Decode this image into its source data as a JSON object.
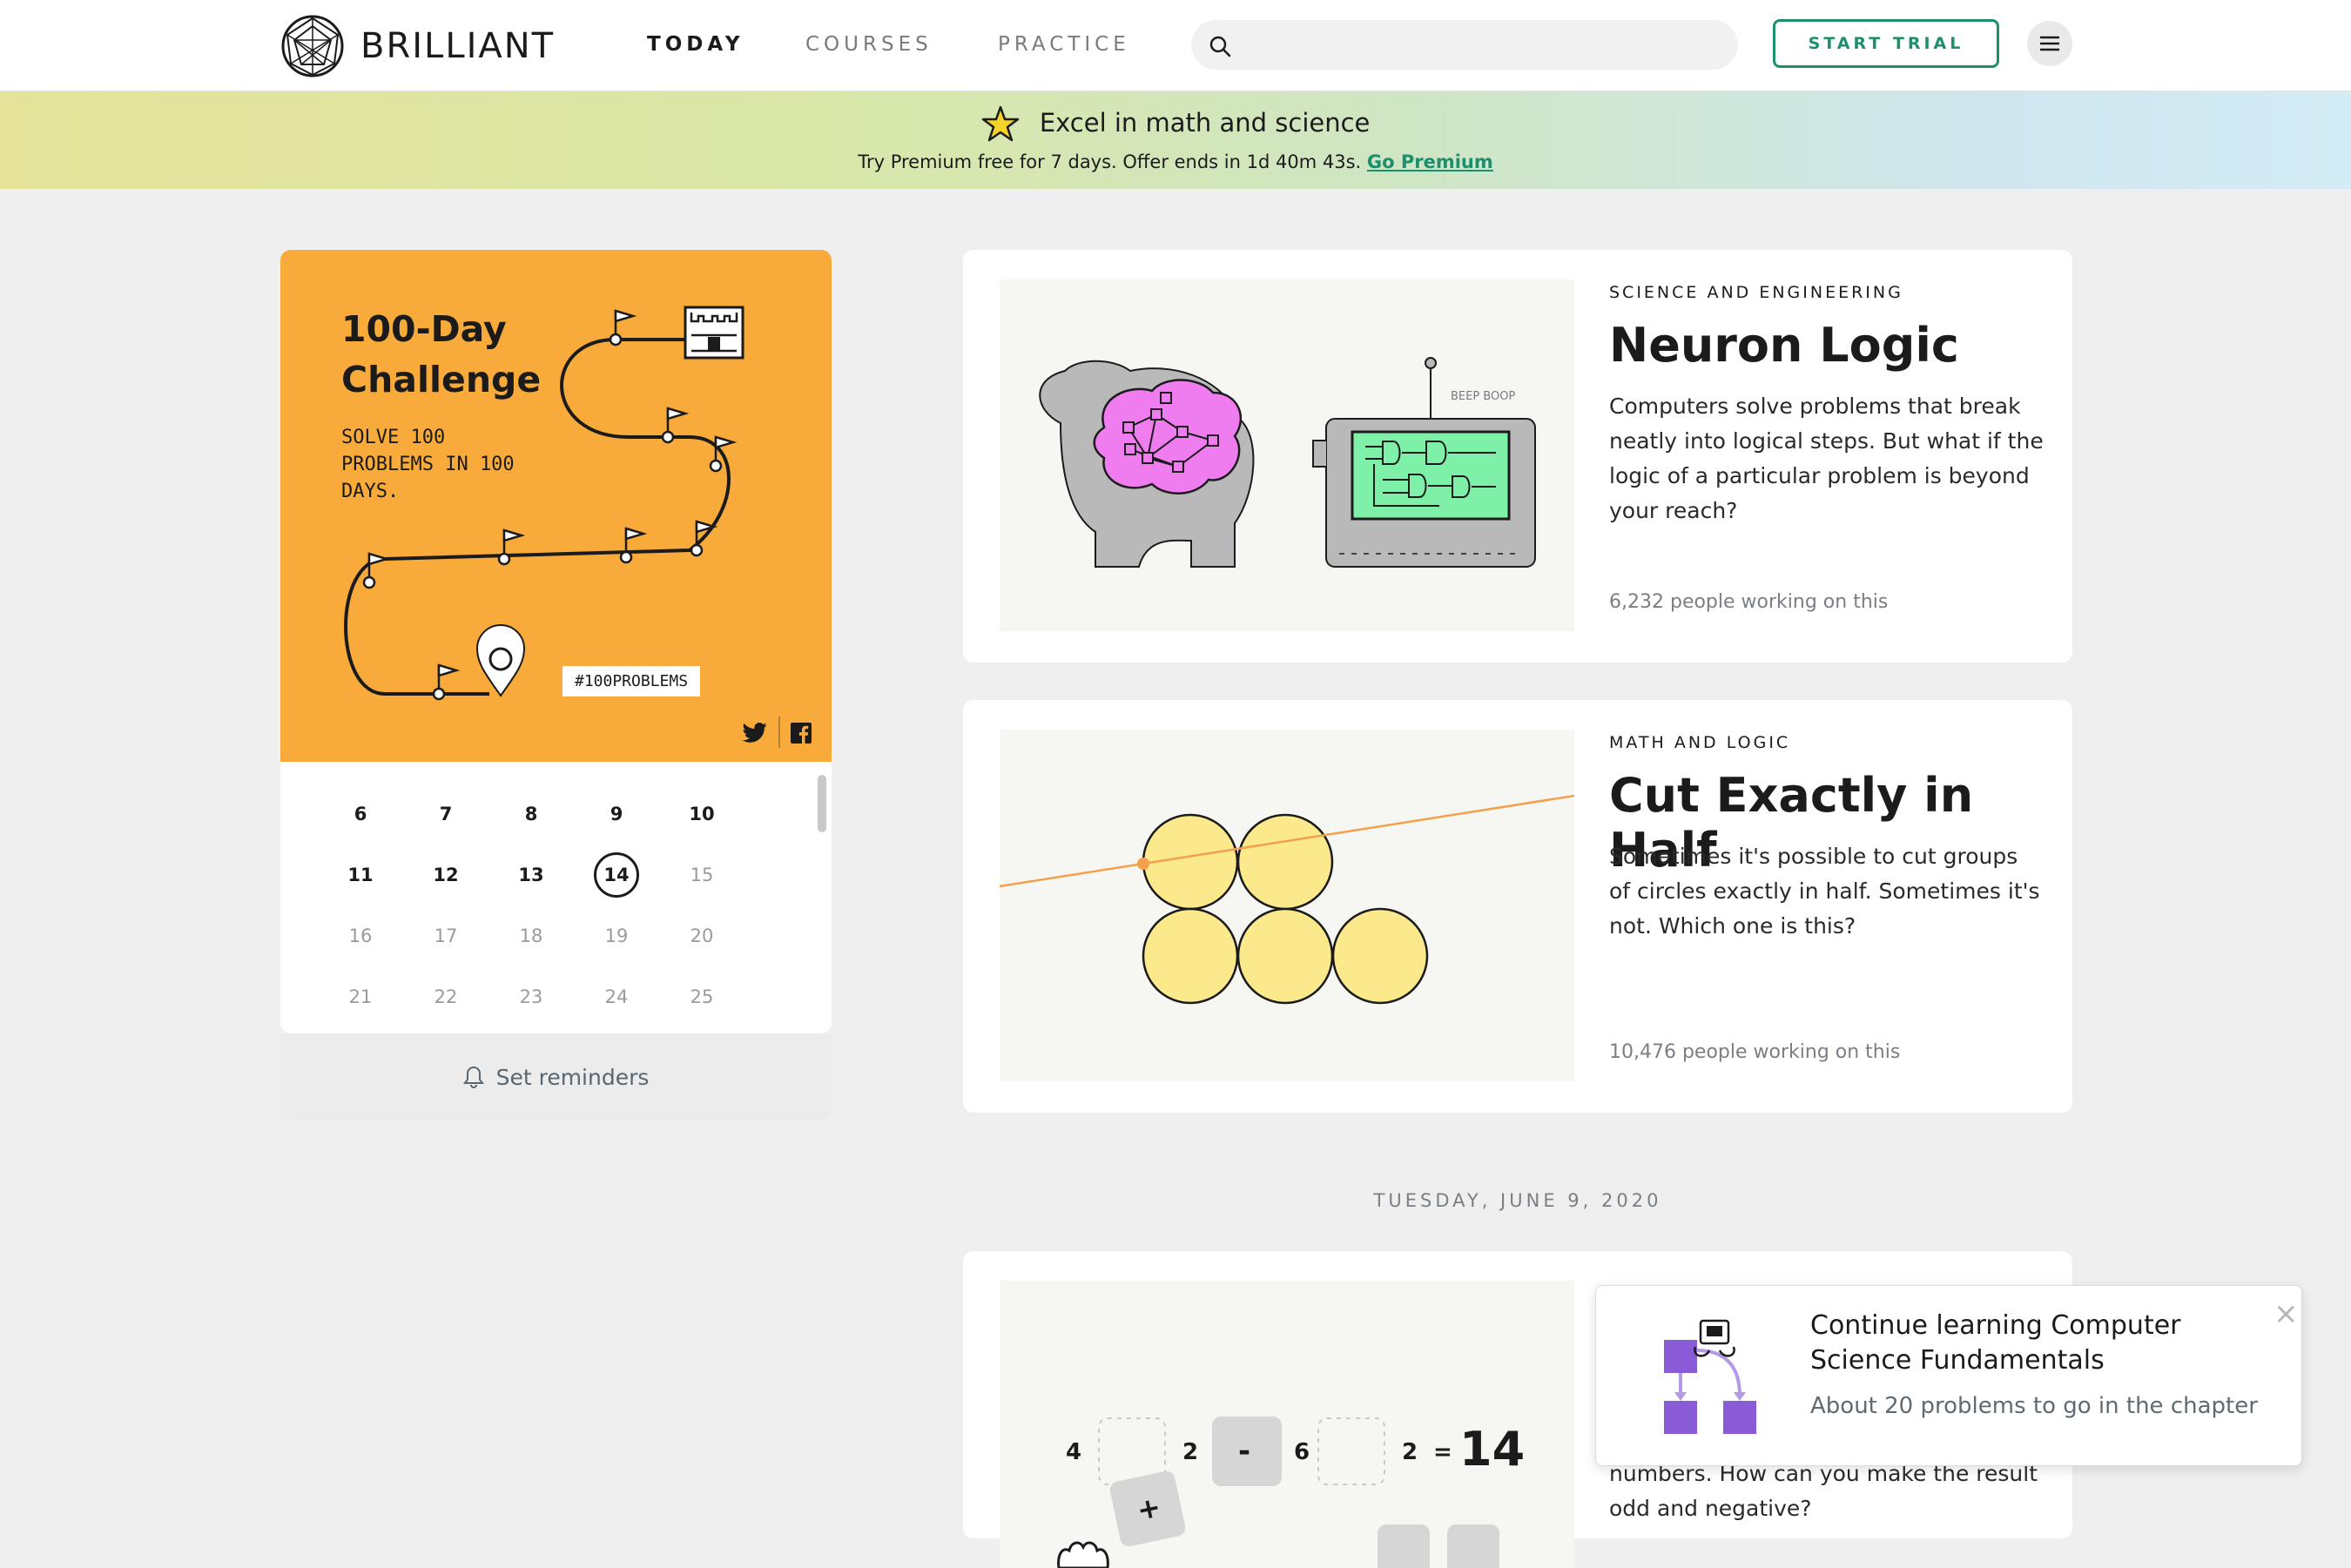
{
  "header": {
    "brand": "BRILLIANT",
    "nav": [
      {
        "label": "TODAY",
        "active": true
      },
      {
        "label": "COURSES",
        "active": false
      },
      {
        "label": "PRACTICE",
        "active": false
      }
    ],
    "search_placeholder": "",
    "trial_button": "START TRIAL"
  },
  "banner": {
    "title": "Excel in math and science",
    "subtitle": "Try Premium free for 7 days. Offer ends in 1d 40m 43s.",
    "link": "Go Premium"
  },
  "challenge": {
    "title_line1": "100-Day",
    "title_line2": "Challenge",
    "subtitle": "SOLVE 100 PROBLEMS IN 100 DAYS.",
    "hashtag": "#100PROBLEMS",
    "calendar": [
      [
        "6",
        "7",
        "8",
        "9",
        "10"
      ],
      [
        "11",
        "12",
        "13",
        "14",
        "15"
      ],
      [
        "16",
        "17",
        "18",
        "19",
        "20"
      ],
      [
        "21",
        "22",
        "23",
        "24",
        "25"
      ]
    ],
    "today": "14",
    "reminders": "Set reminders"
  },
  "problems": [
    {
      "category": "SCIENCE AND ENGINEERING",
      "title": "Neuron Logic",
      "description": "Computers solve problems that break neatly into logical steps. But what if the logic of a particular problem is beyond your reach?",
      "count": "6,232 people working on this",
      "illus_label": "BEEP BOOP"
    },
    {
      "category": "MATH AND LOGIC",
      "title": "Cut Exactly in Half",
      "description": "Sometimes it's possible to cut groups of circles exactly in half. Sometimes it's not. Which one is this?",
      "count": "10,476 people working on this"
    },
    {
      "description_tail": "numbers. How can you make the result odd and negative?",
      "equation": {
        "n1": "4",
        "n2": "2",
        "op": "-",
        "n3": "6",
        "n4": "2",
        "eq": "=",
        "result": "14",
        "tile": "+"
      }
    }
  ],
  "date_label": "TUESDAY, JUNE 9, 2020",
  "toast": {
    "title": "Continue learning Computer Science Fundamentals",
    "subtitle": "About 20 problems to go in the chapter",
    "close": "×"
  },
  "colors": {
    "accent": "#1e8f6e",
    "challenge_bg": "#f8ab3b",
    "brain": "#f07df0",
    "screen": "#7ef0a8",
    "circle": "#fbe98c",
    "cut_line": "#f4a04a",
    "toast_icon": "#8a5bd6"
  }
}
